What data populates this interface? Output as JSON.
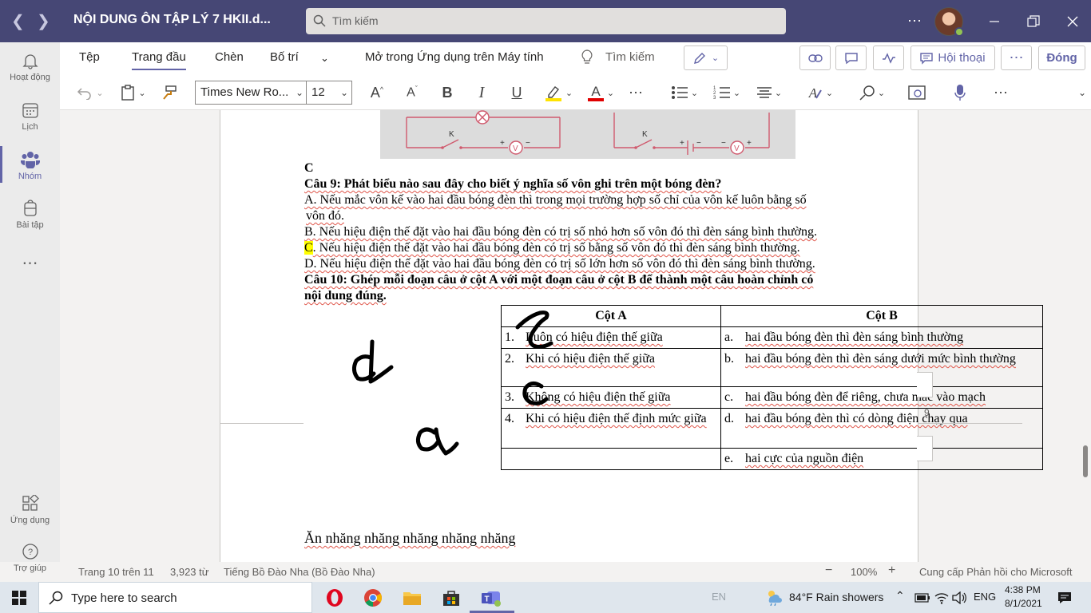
{
  "window": {
    "doc_title": "NỘI DUNG ÔN TẬP LÝ 7 HKII.d...",
    "search_placeholder": "Tìm kiếm"
  },
  "rail": {
    "items": [
      {
        "label": "Hoạt động",
        "icon": "bell-icon"
      },
      {
        "label": "Lịch",
        "icon": "calendar-icon"
      },
      {
        "label": "Nhóm",
        "icon": "teams-icon"
      },
      {
        "label": "Bài tập",
        "icon": "assignments-icon"
      },
      {
        "label": "Ứng dụng",
        "icon": "apps-icon"
      },
      {
        "label": "Trợ giúp",
        "icon": "help-icon"
      }
    ]
  },
  "ribbon": {
    "tabs": [
      "Tệp",
      "Trang đầu",
      "Chèn",
      "Bố trí"
    ],
    "open_desktop": "Mở trong Ứng dụng trên Máy tính",
    "search_label": "Tìm kiếm",
    "conversation_label": "Hội thoại",
    "close_label": "Đóng",
    "font_name": "Times New Ro...",
    "font_size": "12"
  },
  "document": {
    "answer_c": "C",
    "q9_title": "Câu 9: Phát biểu nào sau đây cho biết ý nghĩa số vôn ghi trên một bóng đèn?",
    "q9_a1": "A. Nếu mắc vôn kế vào hai đầu bóng đèn thì trong mọi trường hợp số chỉ của vôn kế luôn bằng số",
    "q9_a2": "vôn đó.",
    "q9_b": "B. Nếu hiệu điện thế đặt vào hai đầu bóng đèn có trị số nhỏ hơn số vôn đó thì đèn sáng bình thường.",
    "q9_c_letter": "C",
    "q9_c_rest": ". Nếu hiệu điện thế đặt vào hai đầu bóng đèn có trị số bằng số vôn đó thì đèn sáng bình thường.",
    "q9_d": "D. Nếu hiệu điện thế đặt vào hai đầu bóng đèn có trị số lớn hơn số vôn đó thì đèn sáng bình thường.",
    "q10_line1": "Câu 10: Ghép mỗi đoạn câu ở cột A với một đoạn câu ở cột B để thành một câu hoàn chỉnh có",
    "q10_line2": "nội dung đúng.",
    "col_a_header": "Cột A",
    "col_b_header": "Cột B",
    "rows": [
      {
        "a_num": "1.",
        "a_text": "Luôn có hiệu điện thế giữa",
        "b_num": "a.",
        "b_text": "hai đầu bóng đèn thì đèn sáng bình thường"
      },
      {
        "a_num": "2.",
        "a_text": "Khi có hiệu điện thế giữa",
        "b_num": "b.",
        "b_text": "hai đầu bóng đèn thì đèn sáng dưới mức bình thường"
      },
      {
        "a_num": "3.",
        "a_text": "Không có hiệu điện thế giữa",
        "b_num": "c.",
        "b_text": "hai đầu bóng đèn để riêng, chưa mắc vào mạch"
      },
      {
        "a_num": "4.",
        "a_text": "Khi có hiệu điện thế định mức giữa",
        "b_num": "d.",
        "b_text": "hai đầu bóng đèn thì có dòng điện chạy qua"
      },
      {
        "a_num": "",
        "a_text": "",
        "b_num": "e.",
        "b_text": "hai cực của nguồn điện"
      }
    ],
    "handwritten_answers": [
      "c",
      "d",
      "c",
      "a"
    ],
    "extra_line": "Ăn nhăng nhăng nhăng nhăng nhăng",
    "page_marker": "9"
  },
  "status": {
    "page": "Trang 10 trên 11",
    "words": "3,923 từ",
    "language": "Tiếng Bồ Đào Nha (Bồ Đào Nha)",
    "zoom": "100%",
    "feedback": "Cung cấp Phản hồi cho Microsoft"
  },
  "taskbar": {
    "search_placeholder": "Type here to search",
    "weather": "84°F  Rain showers",
    "lang": "ENG",
    "time": "4:38 PM",
    "date": "8/1/2021",
    "ime": "EN"
  },
  "colors": {
    "title_bar": "#464775",
    "accent": "#6264a7",
    "circuit": "#d05a6e"
  }
}
